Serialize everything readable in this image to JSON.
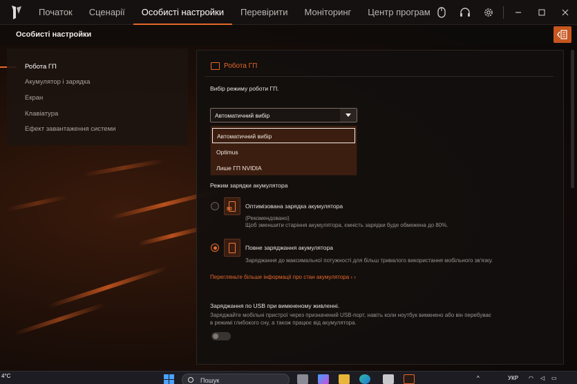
{
  "nav": {
    "tabs": [
      "Початок",
      "Сценарії",
      "Особисті настройки",
      "Перевірити",
      "Моніторинг",
      "Центр програм"
    ],
    "active": "Особисті настройки"
  },
  "header": {
    "title": "Особисті настройки"
  },
  "sidebar": {
    "items": [
      {
        "label": "Робота ГП",
        "active": true
      },
      {
        "label": "Акумулятор і зарядка"
      },
      {
        "label": "Екран"
      },
      {
        "label": "Клавіатура"
      },
      {
        "label": "Ефект завантаження системи"
      }
    ]
  },
  "gpu": {
    "title": "Робота ГП",
    "description": "Вибір режиму роботи ГП.",
    "select_value": "Автоматичний вибір",
    "options": [
      "Автоматичний вибір",
      "Optimus",
      "Лише ГП NVIDIA"
    ]
  },
  "battery": {
    "title": "Режим зарядки акумулятора",
    "optimized": {
      "label": "Оптимізована зарядка акумулятора",
      "badge": "80",
      "note": "(Рекомендовано)",
      "desc": "Щоб зменшити старіння акумулятора, ємність зарядки буде обмежена до 80%.",
      "selected": false
    },
    "full": {
      "label": "Повне заряджання акумулятора",
      "desc": "Заряджання до максимальної потужності для більш тривалого використання мобільного зв'язку.",
      "selected": true
    },
    "more_link": "Перегляньте більше інформації про стан акумулятора › ›"
  },
  "usb": {
    "title": "Заряджання по USB при вимкненому живленні.",
    "desc_line1": "Заряджайте мобільні пристрої через призначений USB-порт, навіть коли ноутбук вимкнено або він перебуває",
    "desc_line2": "в режимі глибокого сну, а також працює від акумулятора.",
    "enabled": false
  },
  "taskbar": {
    "temp": "4°C",
    "search_placeholder": "Пошук",
    "lang": "УКР"
  },
  "colors": {
    "accent": "#e7672a",
    "panel": "#12100f",
    "dropdown": "#3c1e10"
  }
}
